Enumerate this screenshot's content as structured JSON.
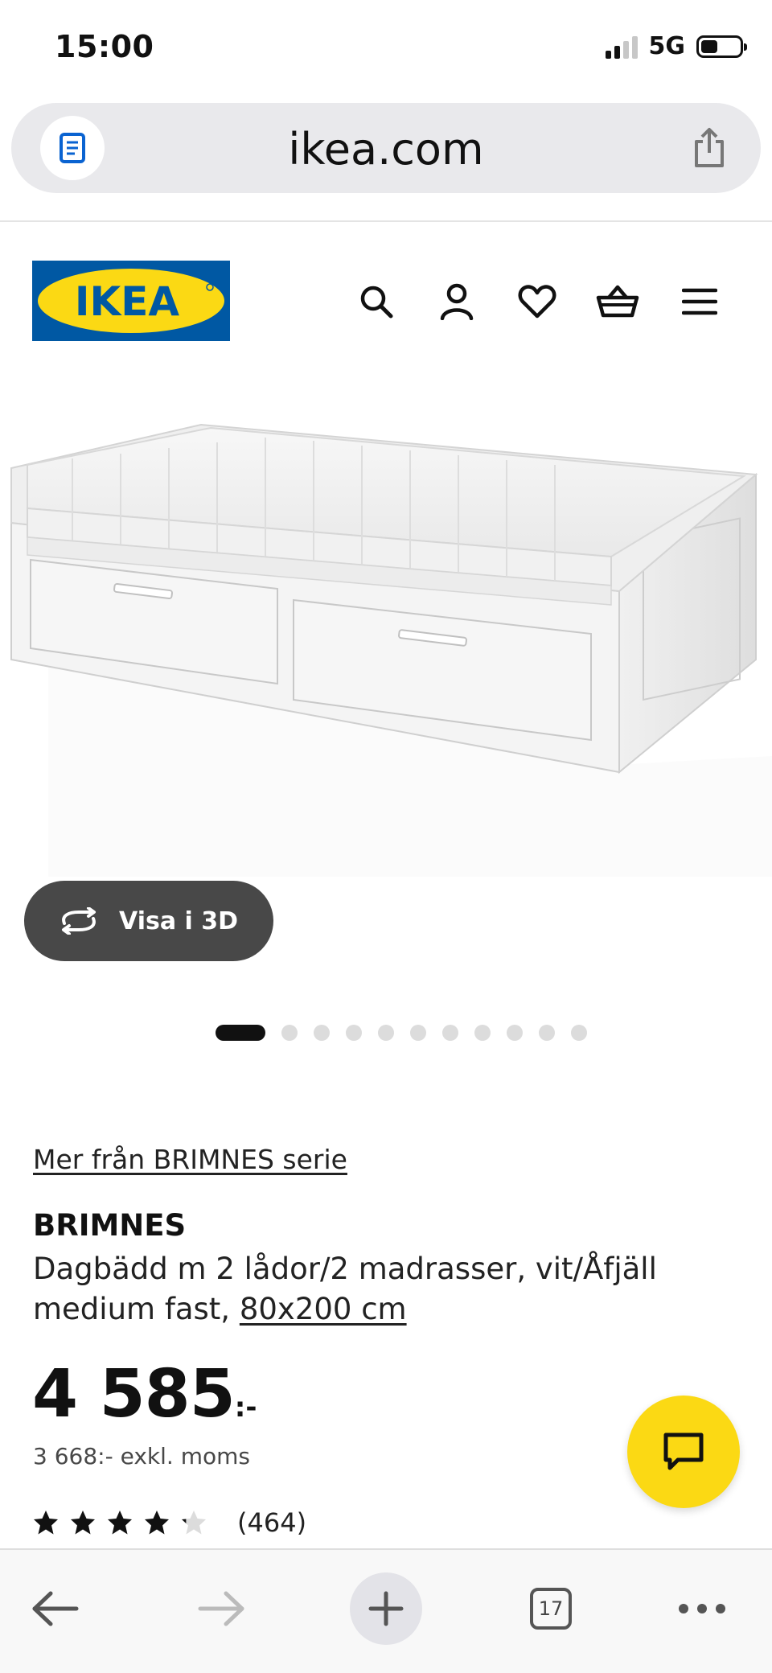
{
  "status_bar": {
    "time": "15:00",
    "network": "5G"
  },
  "browser": {
    "url": "ikea.com",
    "tabs_count": "17"
  },
  "header": {
    "logo_text": "IKEA",
    "icons": [
      "search-icon",
      "user-icon",
      "heart-icon",
      "basket-icon",
      "menu-icon"
    ]
  },
  "gallery": {
    "view_3d_label": "Visa i 3D",
    "total_images": 11,
    "active_index": 0
  },
  "product": {
    "series_link": "Mer från BRIMNES serie",
    "name": "BRIMNES",
    "description": "Dagbädd m 2 lådor/2 madrasser, vit/Åfjäll medium fast,",
    "size_link": "80x200 cm",
    "price": "4 585",
    "price_suffix": ":-",
    "price_excl_vat": "3 668:- exkl. moms",
    "rating": {
      "value": 4.2,
      "max": 5
    },
    "review_count": "(464)"
  },
  "colors": {
    "ikea_blue": "#0058a3",
    "ikea_yellow": "#fbd914",
    "button_dark": "#484848"
  }
}
